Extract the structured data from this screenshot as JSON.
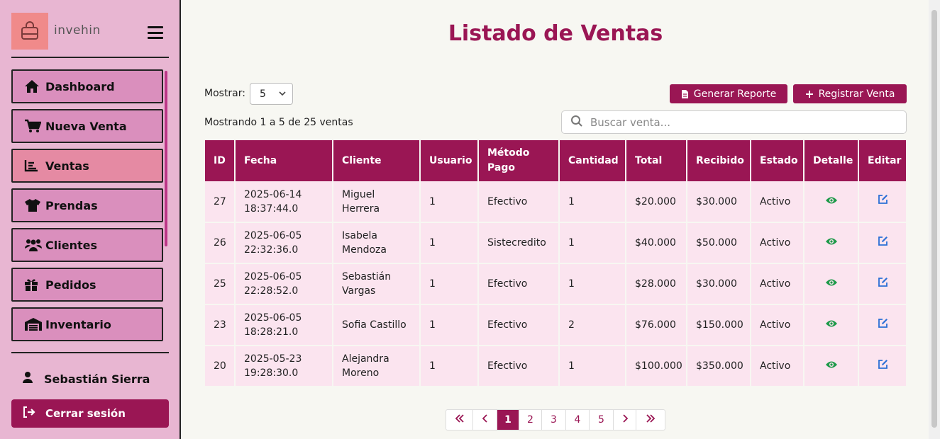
{
  "brand": {
    "name": "invehin",
    "logo_icon": "shopping-bag-icon",
    "logo_color": "#f08a8a"
  },
  "colors": {
    "accent": "#9a1654",
    "sidebar": "#e8b6d2",
    "nav_item": "#da8fbd",
    "nav_active": "#e58aa3",
    "row": "#fbe4ef",
    "view_icon": "#1e9a4a",
    "edit_icon": "#2a6fd6"
  },
  "sidebar": {
    "items": [
      {
        "label": "Dashboard",
        "icon": "home-icon"
      },
      {
        "label": "Nueva Venta",
        "icon": "cart-icon"
      },
      {
        "label": "Ventas",
        "icon": "chart-line-icon",
        "active": true
      },
      {
        "label": "Prendas",
        "icon": "shirt-icon"
      },
      {
        "label": "Clientes",
        "icon": "users-icon"
      },
      {
        "label": "Pedidos",
        "icon": "gift-icon"
      },
      {
        "label": "Inventario",
        "icon": "warehouse-icon"
      }
    ],
    "user_name": "Sebastián Sierra",
    "logout_label": "Cerrar sesión"
  },
  "main": {
    "title": "Listado de Ventas",
    "show_label": "Mostrar:",
    "page_size": "5",
    "count_text": "Mostrando 1 a 5 de 25 ventas",
    "report_button": "Generar Reporte",
    "register_button": "Registrar Venta",
    "search_placeholder": "Buscar venta..."
  },
  "table": {
    "headers": [
      "ID",
      "Fecha",
      "Cliente",
      "Usuario",
      "Método Pago",
      "Cantidad",
      "Total",
      "Recibido",
      "Estado",
      "Detalle",
      "Editar"
    ],
    "rows": [
      {
        "id": "27",
        "fecha": "2025-06-14 18:37:44.0",
        "cliente": "Miguel Herrera",
        "usuario": "1",
        "metodo": "Efectivo",
        "cantidad": "1",
        "total": "$20.000",
        "recibido": "$30.000",
        "estado": "Activo"
      },
      {
        "id": "26",
        "fecha": "2025-06-05 22:32:36.0",
        "cliente": "Isabela Mendoza",
        "usuario": "1",
        "metodo": "Sistecredito",
        "cantidad": "1",
        "total": "$40.000",
        "recibido": "$50.000",
        "estado": "Activo"
      },
      {
        "id": "25",
        "fecha": "2025-06-05 22:28:52.0",
        "cliente": "Sebastián Vargas",
        "usuario": "1",
        "metodo": "Efectivo",
        "cantidad": "1",
        "total": "$28.000",
        "recibido": "$30.000",
        "estado": "Activo"
      },
      {
        "id": "23",
        "fecha": "2025-06-05 18:28:21.0",
        "cliente": "Sofia Castillo",
        "usuario": "1",
        "metodo": "Efectivo",
        "cantidad": "2",
        "total": "$76.000",
        "recibido": "$150.000",
        "estado": "Activo"
      },
      {
        "id": "20",
        "fecha": "2025-05-23 19:28:30.0",
        "cliente": "Alejandra Moreno",
        "usuario": "1",
        "metodo": "Efectivo",
        "cantidad": "1",
        "total": "$100.000",
        "recibido": "$350.000",
        "estado": "Activo"
      }
    ]
  },
  "pagination": {
    "first": "«",
    "prev": "‹",
    "pages": [
      "1",
      "2",
      "3",
      "4",
      "5"
    ],
    "current": "1",
    "next": "›",
    "last": "»"
  }
}
